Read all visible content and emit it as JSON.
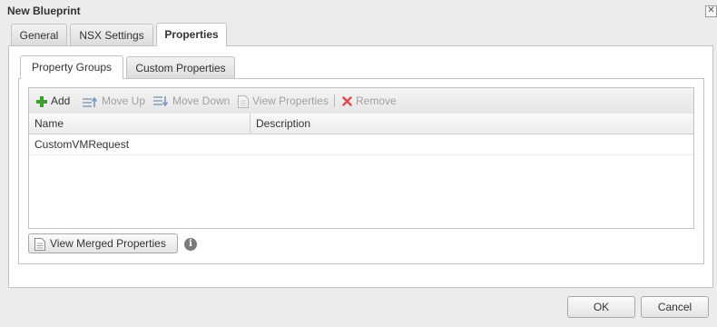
{
  "window": {
    "title": "New Blueprint",
    "close_glyph": "✕"
  },
  "main_tabs": [
    {
      "label": "General",
      "active": false
    },
    {
      "label": "NSX Settings",
      "active": false
    },
    {
      "label": "Properties",
      "active": true
    }
  ],
  "sub_tabs": [
    {
      "label": "Property Groups",
      "active": true
    },
    {
      "label": "Custom Properties",
      "active": false
    }
  ],
  "toolbar": {
    "add": "Add",
    "move_up": "Move Up",
    "move_down": "Move Down",
    "view_properties": "View Properties",
    "remove": "Remove"
  },
  "table": {
    "columns": [
      "Name",
      "Description"
    ],
    "rows": [
      {
        "name": "CustomVMRequest",
        "description": ""
      }
    ]
  },
  "view_merged_label": "View Merged Properties",
  "info_glyph": "i",
  "footer": {
    "ok": "OK",
    "cancel": "Cancel"
  },
  "colors": {
    "add_green": "#3aa12a",
    "remove_red": "#e04a4a",
    "disabled_text": "#a0a0a0"
  }
}
